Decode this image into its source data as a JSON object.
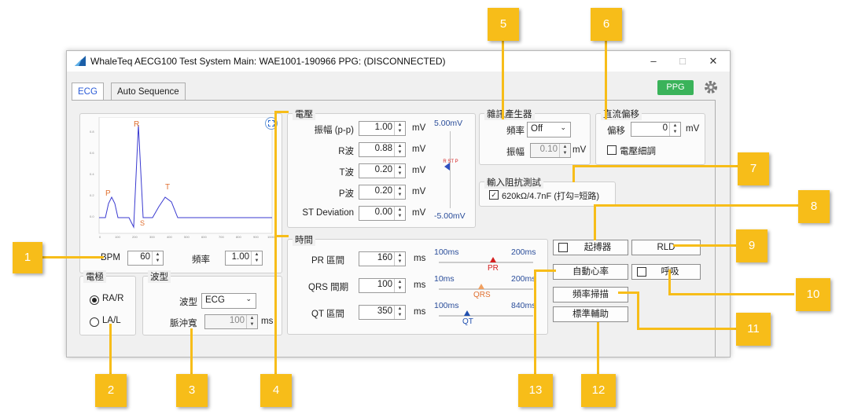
{
  "window": {
    "title": "WhaleTeq AECG100 Test System   Main: WAE1001-190966  PPG: (DISCONNECTED)",
    "min": "–",
    "max": "□",
    "close": "✕"
  },
  "tabs": [
    "ECG",
    "Auto Sequence"
  ],
  "ppg_button": "PPG",
  "waveform_labels": {
    "p": "P",
    "r": "R",
    "t": "T",
    "s": "S"
  },
  "graph": {
    "y_ticks": [
      "0.8",
      "0.6",
      "0.4",
      "0.2",
      "0.0"
    ],
    "x_ticks": [
      "0",
      "100",
      "200",
      "300",
      "400",
      "500",
      "600",
      "700",
      "800",
      "900",
      "1000"
    ]
  },
  "bpm": {
    "label": "BPM",
    "value": "60"
  },
  "freq": {
    "label": "頻率",
    "value": "1.00"
  },
  "electrode": {
    "group": "電極",
    "opt1": "RA/R",
    "opt2": "LA/L"
  },
  "waveform": {
    "group": "波型",
    "type_label": "波型",
    "type_value": "ECG",
    "pulse_label": "脈沖寬",
    "pulse_value": "100",
    "pulse_unit": "ms"
  },
  "voltage": {
    "group": "電壓",
    "rows": [
      {
        "label": "振幅 (p-p)",
        "value": "1.00",
        "unit": "mV"
      },
      {
        "label": "R波",
        "value": "0.88",
        "unit": "mV"
      },
      {
        "label": "T波",
        "value": "0.20",
        "unit": "mV"
      },
      {
        "label": "P波",
        "value": "0.20",
        "unit": "mV"
      },
      {
        "label": "ST Deviation",
        "value": "0.00",
        "unit": "mV"
      }
    ],
    "scale_top": "5.00mV",
    "scale_bottom": "-5.00mV",
    "marker_labels": "R ST P"
  },
  "timing": {
    "group": "時間",
    "rows": [
      {
        "label": "PR 區間",
        "value": "160",
        "unit": "ms",
        "min": "100ms",
        "max": "200ms",
        "marker": "PR"
      },
      {
        "label": "QRS 間期",
        "value": "100",
        "unit": "ms",
        "min": "10ms",
        "max": "200ms",
        "marker": "QRS"
      },
      {
        "label": "QT 區間",
        "value": "350",
        "unit": "ms",
        "min": "100ms",
        "max": "840ms",
        "marker": "QT"
      }
    ]
  },
  "noise": {
    "group": "雜訊產生器",
    "freq_label": "頻率",
    "freq_value": "Off",
    "amp_label": "振幅",
    "amp_value": "0.10",
    "amp_unit": "mV"
  },
  "dc_offset": {
    "group": "直流偏移",
    "offset_label": "偏移",
    "offset_value": "0",
    "unit": "mV",
    "fine_label": "電壓細調"
  },
  "impedance": {
    "group": "輸入阻抗測試",
    "check_label": "620kΩ/4.7nF (打勾=短路)"
  },
  "buttons": {
    "pacemaker": "起搏器",
    "rld": "RLD",
    "auto_hr": "自動心率",
    "respiration": "呼吸",
    "freq_sweep": "頻率掃描",
    "calibration": "標準輔助"
  },
  "callouts": [
    "1",
    "2",
    "3",
    "4",
    "5",
    "6",
    "7",
    "8",
    "9",
    "10",
    "11",
    "12",
    "13"
  ],
  "colors": {
    "accent": "#f7bd19",
    "ppg": "#3ab35a",
    "wave": "#3a3ad0",
    "orange": "#e07030",
    "red": "#d42020",
    "blue": "#2050b0"
  }
}
